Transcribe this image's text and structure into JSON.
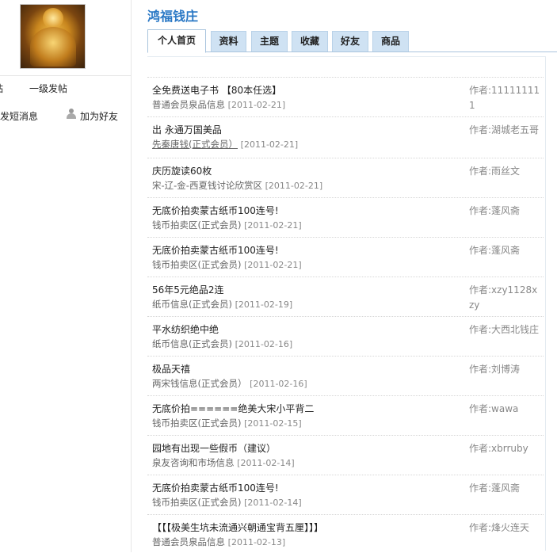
{
  "sidebar": {
    "avatar_alt": "user avatar",
    "first_post_prefix": "贴",
    "first_post": "一级发帖",
    "send_message": "发短消息",
    "add_friend": "加为好友"
  },
  "page_title": "鸿福钱庄",
  "tabs": [
    {
      "label": "个人首页",
      "active": true
    },
    {
      "label": "资料",
      "active": false
    },
    {
      "label": "主题",
      "active": false
    },
    {
      "label": "收藏",
      "active": false
    },
    {
      "label": "好友",
      "active": false
    },
    {
      "label": "商品",
      "active": false
    }
  ],
  "feed": [
    {
      "title": "全免费送电子书  【80本任选】",
      "source": "普通会员泉品信息",
      "date": "[2011-02-21]",
      "author": "作者:111111111"
    },
    {
      "title": "出  永通万国美品",
      "source": "先秦唐钱(正式会员）",
      "date": "[2011-02-21]",
      "author": "作者:湖城老五哥",
      "underline": true
    },
    {
      "title": "庆历旋读60枚",
      "source": "宋-辽-金-西夏钱讨论欣赏区",
      "date": "[2011-02-21]",
      "author": "作者:雨丝文"
    },
    {
      "title": "无底价拍卖蒙古纸币100连号!",
      "source": "钱币拍卖区(正式会员)",
      "date": "[2011-02-21]",
      "author": "作者:蓬风斋"
    },
    {
      "title": "无底价拍卖蒙古纸币100连号!",
      "source": "钱币拍卖区(正式会员)",
      "date": "[2011-02-21]",
      "author": "作者:蓬风斋"
    },
    {
      "title": "56年5元绝品2连",
      "source": "纸币信息(正式会员)",
      "date": "[2011-02-19]",
      "author": "作者:xzy1128xzy"
    },
    {
      "title": "平水纺织绝中绝",
      "source": "纸币信息(正式会员)",
      "date": "[2011-02-16]",
      "author": "作者:大西北钱庄"
    },
    {
      "title": "极品天禧",
      "source": "两宋钱信息(正式会员）",
      "date": "[2011-02-16]",
      "author": "作者:刘博涛"
    },
    {
      "title": "无底价拍======绝美大宋小平背二",
      "source": "钱币拍卖区(正式会员)",
      "date": "[2011-02-15]",
      "author": "作者:wawa"
    },
    {
      "title": "园地有出现一些假币（建议）",
      "source": "泉友咨询和市场信息",
      "date": "[2011-02-14]",
      "author": "作者:xbrruby"
    },
    {
      "title": "无底价拍卖蒙古纸币100连号!",
      "source": "钱币拍卖区(正式会员)",
      "date": "[2011-02-14]",
      "author": "作者:蓬风斋"
    },
    {
      "title": "【【【极美生坑未流通兴朝通宝背五厘】】】",
      "source": "普通会员泉品信息",
      "date": "[2011-02-13]",
      "author": "作者:烽火连天"
    }
  ]
}
